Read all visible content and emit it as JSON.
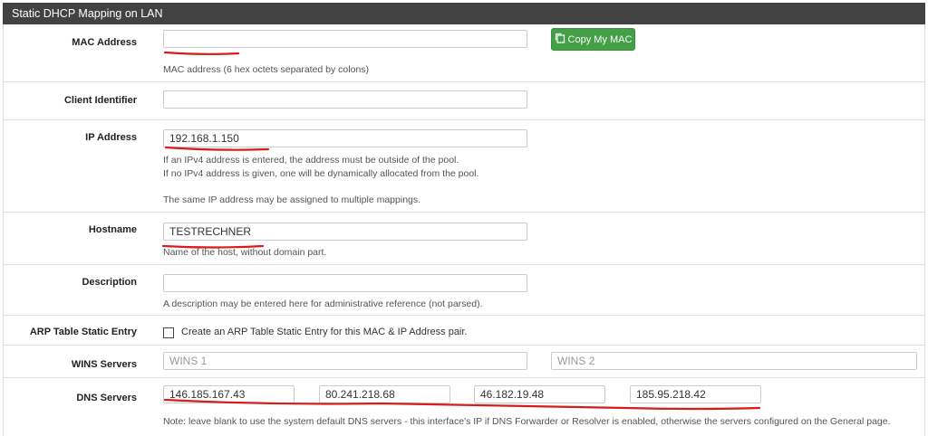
{
  "panel": {
    "title": "Static DHCP Mapping on LAN"
  },
  "mac": {
    "label": "MAC Address",
    "value": "",
    "button_label": "Copy My MAC",
    "help": "MAC address (6 hex octets separated by colons)"
  },
  "client_id": {
    "label": "Client Identifier",
    "value": ""
  },
  "ip": {
    "label": "IP Address",
    "value": "192.168.1.150",
    "help_lines": [
      "If an IPv4 address is entered, the address must be outside of the pool.",
      "If no IPv4 address is given, one will be dynamically allocated from the pool.",
      "The same IP address may be assigned to multiple mappings."
    ]
  },
  "hostname": {
    "label": "Hostname",
    "value": "TESTRECHNER",
    "help": "Name of the host, without domain part."
  },
  "description": {
    "label": "Description",
    "value": "",
    "help": "A description may be entered here for administrative reference (not parsed)."
  },
  "arp": {
    "label": "ARP Table Static Entry",
    "checked": false,
    "checkbox_label": "Create an ARP Table Static Entry for this MAC & IP Address pair."
  },
  "wins": {
    "label": "WINS Servers",
    "placeholder_1": "WINS 1",
    "placeholder_2": "WINS 2"
  },
  "dns": {
    "label": "DNS Servers",
    "servers": [
      "146.185.167.43",
      "80.241.218.68",
      "46.182.19.48",
      "185.95.218.42"
    ],
    "help": "Note: leave blank to use the system default DNS servers - this interface's IP if DNS Forwarder or Resolver is enabled, otherwise the servers configured on the General page."
  },
  "colors": {
    "heading_bg": "#424242",
    "button_green": "#43a047",
    "annotation_red": "#d81b1b"
  },
  "icons": {
    "copy_button": "copy-icon"
  }
}
